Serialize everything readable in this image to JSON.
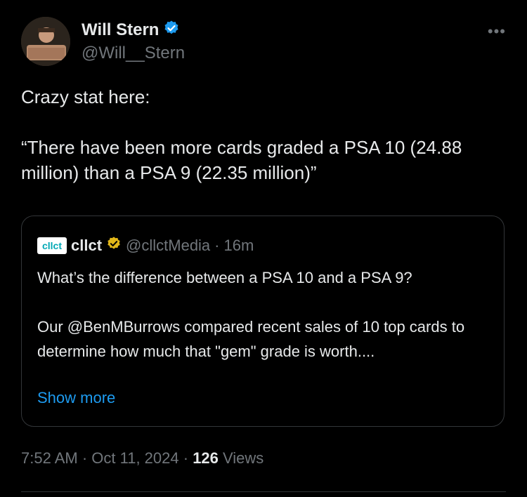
{
  "author": {
    "display_name": "Will Stern",
    "handle": "@Will__Stern",
    "verified_icon": "blue-verified-badge",
    "more_label": "•••"
  },
  "tweet": {
    "text": "Crazy stat here:\n\n“There have been more cards graded a PSA 10 (24.88 million) than a PSA 9 (22.35 million)”"
  },
  "quote": {
    "logo_text": "cllct",
    "display_name": "cllct",
    "verified_icon": "gold-verified-badge",
    "handle": "@cllctMedia",
    "separator": "·",
    "time": "16m",
    "body": "What’s the difference between a PSA 10 and a PSA 9?\n\nOur @BenMBurrows compared recent sales of 10 top cards to determine how much that \"gem\" grade is worth....",
    "show_more": "Show more"
  },
  "meta": {
    "time": "7:52 AM",
    "sep1": " · ",
    "date": "Oct 11, 2024",
    "sep2": " · ",
    "views_count": "126",
    "views_label": " Views"
  },
  "colors": {
    "background": "#000000",
    "text": "#e7e9ea",
    "muted": "#71767b",
    "link": "#1d9bf0",
    "verified_blue": "#1d9bf0",
    "verified_gold": "#e2b719"
  }
}
